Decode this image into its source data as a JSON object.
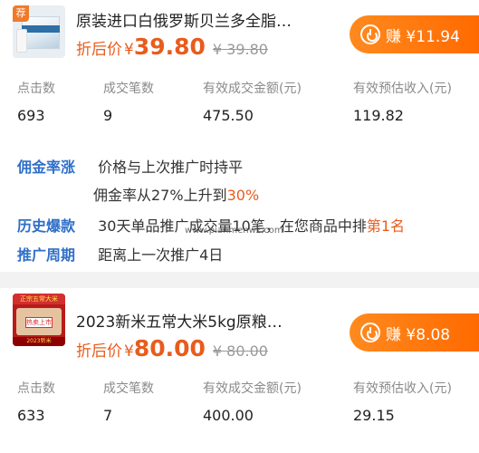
{
  "cards": [
    {
      "tag": "荐",
      "title": "原装进口白俄罗斯贝兰多全脂…",
      "price_label": "折后价",
      "currency": "¥",
      "price": "39.80",
      "original_price": "¥ 39.80",
      "earn_label": "赚 ¥11.94",
      "stats": [
        {
          "label": "点击数",
          "value": "693"
        },
        {
          "label": "成交笔数",
          "value": "9"
        },
        {
          "label": "有效成交金额(元)",
          "value": "475.50"
        },
        {
          "label": "有效预估收入(元)",
          "value": "119.82"
        }
      ],
      "info": {
        "row1_key": "佣金率涨",
        "row1_text": "价格与上次推广时持平",
        "row2_text_before": "佣金率从27%上升到",
        "row2_highlight": "30%",
        "row3_key": "历史爆款",
        "row3_text_before": "30天单品推广成交量10笔，在您商品中排",
        "row3_highlight": "第1名",
        "row4_key": "推广周期",
        "row4_text": "距离上一次推广4日"
      }
    },
    {
      "thumb_banner": "正宗五常大米",
      "thumb_sign": "热卖上市",
      "thumb_foot": "2023新米",
      "title": "2023新米五常大米5kg原粮…",
      "price_label": "折后价",
      "currency": "¥",
      "price": "80.00",
      "original_price": "¥ 80.00",
      "earn_label": "赚 ¥8.08",
      "stats": [
        {
          "label": "点击数",
          "value": "633"
        },
        {
          "label": "成交笔数",
          "value": "7"
        },
        {
          "label": "有效成交金额(元)",
          "value": "400.00"
        },
        {
          "label": "有效预估收入(元)",
          "value": "29.15"
        }
      ]
    }
  ],
  "watermark": "www.pianmenwz.com",
  "colors": {
    "accent": "#ff6a00",
    "price": "#e85c1c",
    "info_key": "#2f6fc8"
  }
}
